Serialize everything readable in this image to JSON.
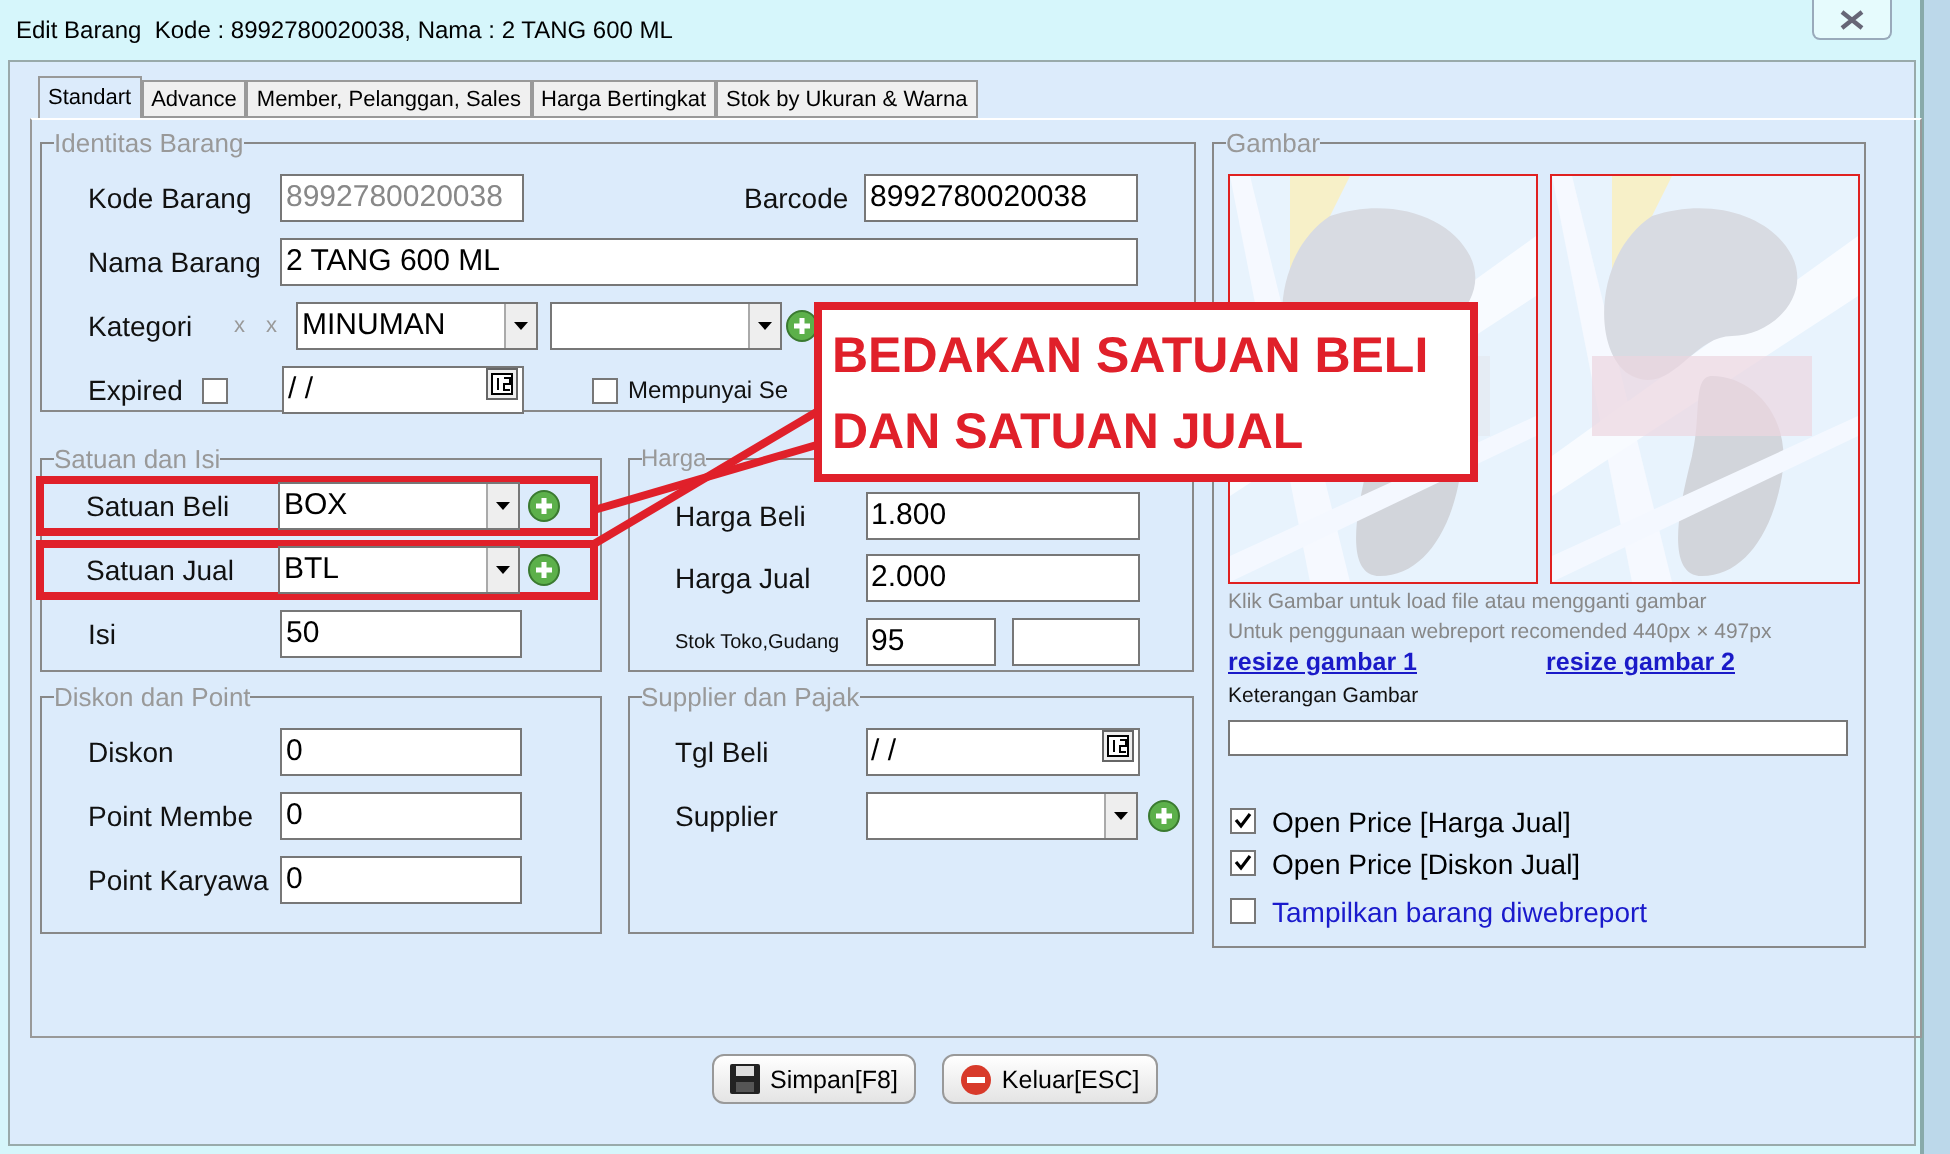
{
  "window": {
    "title": "Edit Barang  Kode : 8992780020038, Nama : 2 TANG 600 ML"
  },
  "tabs": [
    {
      "label": "Standart",
      "selected": true
    },
    {
      "label": "Advance",
      "selected": false
    },
    {
      "label": "Member, Pelanggan, Sales",
      "selected": false
    },
    {
      "label": "Harga Bertingkat",
      "selected": false
    },
    {
      "label": "Stok by Ukuran & Warna",
      "selected": false
    }
  ],
  "identitas": {
    "legend": "Identitas Barang",
    "kode_barang": {
      "label": "Kode Barang",
      "value": "8992780020038",
      "disabled": true
    },
    "barcode": {
      "label": "Barcode",
      "value": "8992780020038"
    },
    "nama_barang": {
      "label": "Nama Barang",
      "value": "2 TANG 600 ML"
    },
    "kategori": {
      "label": "Kategori",
      "marks": [
        "x",
        "x"
      ],
      "value": "MINUMAN"
    },
    "expired": {
      "label": "Expired",
      "checked": false,
      "date": "/  /"
    },
    "mempunyai": {
      "label": "Mempunyai Se",
      "checked": false
    }
  },
  "satuan": {
    "legend": "Satuan dan Isi",
    "rows": [
      {
        "label": "Satuan Beli",
        "value": "BOX",
        "highlighted": true
      },
      {
        "label": "Satuan Jual",
        "value": "BTL",
        "highlighted": true
      }
    ],
    "isi": {
      "label": "Isi",
      "value": "50"
    }
  },
  "harga": {
    "legend": "Harga",
    "harga_beli": {
      "label": "Harga Beli",
      "value": "1.800"
    },
    "harga_jual": {
      "label": "Harga Jual",
      "value": "2.000"
    },
    "stok": {
      "label": "Stok Toko,Gudang",
      "value": "95"
    }
  },
  "diskon": {
    "legend": "Diskon dan Point",
    "fields": [
      {
        "label": "Diskon",
        "value": "0"
      },
      {
        "label": "Point Membe",
        "value": "0"
      },
      {
        "label": "Point Karyawa",
        "value": "0"
      }
    ]
  },
  "supplier": {
    "legend": "Supplier dan Pajak",
    "tgl_beli": {
      "label": "Tgl Beli",
      "value": "/  /"
    },
    "supplier": {
      "label": "Supplier"
    }
  },
  "gambar": {
    "legend": "Gambar",
    "hints": [
      "Klik Gambar untuk load file atau mengganti gambar",
      "Untuk penggunaan webreport recomended 440px × 497px"
    ],
    "links": [
      "resize gambar 1",
      "resize gambar 2"
    ],
    "keterangan_label": "Keterangan Gambar",
    "options": [
      {
        "label": "Open Price [Harga Jual]",
        "checked": true,
        "color": "#000000"
      },
      {
        "label": "Open Price [Diskon Jual]",
        "checked": true,
        "color": "#000000"
      },
      {
        "label": "Tampilkan barang diwebreport",
        "checked": false,
        "color": "#1a1acc"
      }
    ]
  },
  "buttons": [
    {
      "label": "Simpan[F8]",
      "kind": "save"
    },
    {
      "label": "Keluar[ESC]",
      "kind": "exit"
    }
  ],
  "annotation": {
    "lines": [
      "BEDAKAN SATUAN BELI",
      "DAN SATUAN JUAL"
    ]
  }
}
